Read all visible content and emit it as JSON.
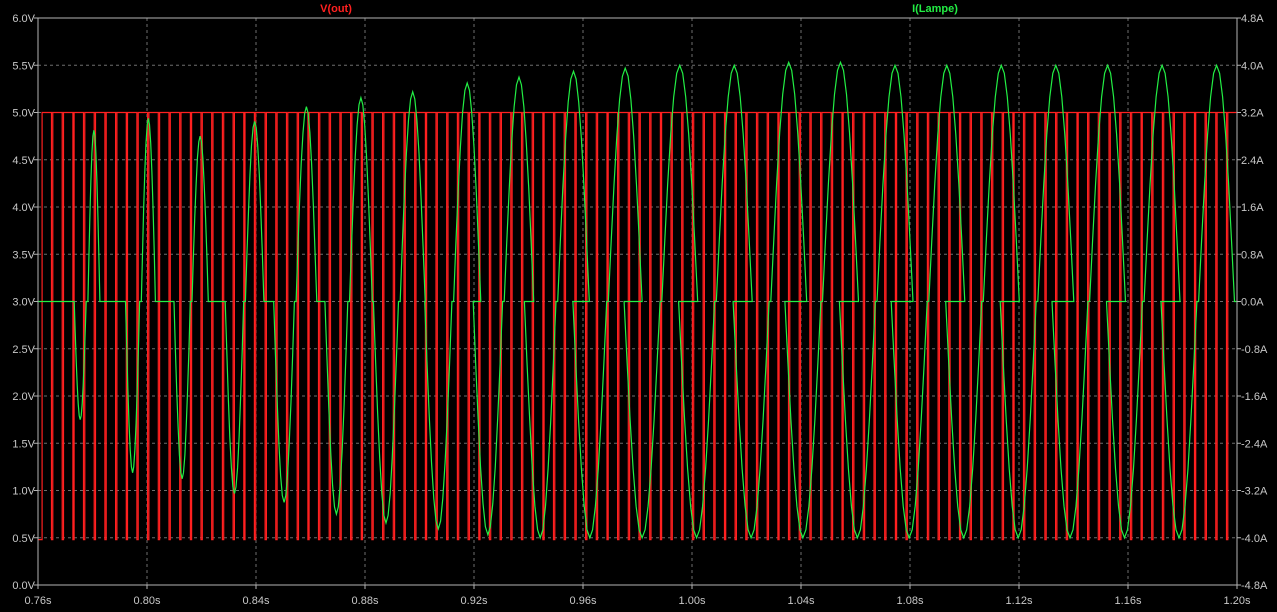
{
  "colors": {
    "background": "#000000",
    "frame": "#b4b4b4",
    "grid": "#6e6e6e",
    "tick_text": "#c8c8c8",
    "vout": "#ff2020",
    "ilampe": "#22ee44"
  },
  "chart_data": {
    "type": "line",
    "grid": true,
    "legend_placement": "top",
    "x_axis": {
      "min": 0.76,
      "max": 1.2,
      "ticks": [
        "0.76s",
        "0.80s",
        "0.84s",
        "0.88s",
        "0.92s",
        "0.96s",
        "1.00s",
        "1.04s",
        "1.08s",
        "1.12s",
        "1.16s",
        "1.20s"
      ]
    },
    "y_left": {
      "min": 0,
      "max": 6,
      "ticks": [
        "0.0V",
        "0.5V",
        "1.0V",
        "1.5V",
        "2.0V",
        "2.5V",
        "3.0V",
        "3.5V",
        "4.0V",
        "4.5V",
        "5.0V",
        "5.5V",
        "6.0V"
      ]
    },
    "y_right": {
      "min": -4.8,
      "max": 4.8,
      "ticks": [
        "-4.8A",
        "-4.0A",
        "-3.2A",
        "-2.4A",
        "-1.6A",
        "-0.8A",
        "0.0A",
        "0.8A",
        "1.6A",
        "2.4A",
        "3.2A",
        "4.0A",
        "4.8A"
      ]
    },
    "series": [
      {
        "name": "V(out)",
        "axis": "left",
        "shape": "square_pwm",
        "low": 0.48,
        "high": 5.0,
        "period_s": 0.00392,
        "start_s": 0.7615
      },
      {
        "name": "I(Lampe)",
        "axis": "right",
        "shape": "pulsed_sine",
        "period_s": 0.0196,
        "peaks_s": [
          0.7805,
          0.8005,
          0.8195,
          0.8395,
          0.8585,
          0.8785,
          0.8975,
          0.9175,
          0.9365,
          0.9565,
          0.9755,
          0.9955,
          1.0155,
          1.0355,
          1.0545,
          1.0745,
          1.0935,
          1.1135,
          1.1335,
          1.1525,
          1.1725,
          1.1925
        ],
        "peak_values_A": [
          2.9,
          3.1,
          2.8,
          3.05,
          3.3,
          3.45,
          3.55,
          3.7,
          3.8,
          3.9,
          3.95,
          4.0,
          4.0,
          4.05,
          4.05,
          4.0,
          4.0,
          4.0,
          4.0,
          4.0,
          4.0,
          4.0
        ],
        "trough_values_A": [
          -2.0,
          -2.9,
          -3.0,
          -3.25,
          -3.4,
          -3.6,
          -3.75,
          -3.85,
          -3.95,
          -4.0,
          -4.0,
          -4.0,
          -4.0,
          -4.0,
          -4.0,
          -4.0,
          -4.0,
          -4.0,
          -4.0,
          -4.0,
          -4.0,
          -4.0
        ],
        "zero_level_A": 0.0
      }
    ]
  }
}
